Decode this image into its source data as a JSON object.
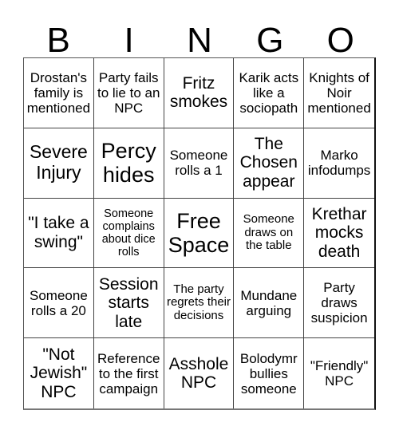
{
  "header": {
    "letters": [
      "B",
      "I",
      "N",
      "G",
      "O"
    ]
  },
  "board": {
    "cells": [
      "Drostan's family is mentioned",
      "Party fails to lie to an NPC",
      "Fritz smokes",
      "Karik acts like a sociopath",
      "Knights of Noir mentioned",
      "Severe Injury",
      "Percy hides",
      "Someone rolls a 1",
      "The Chosen appear",
      "Marko infodumps",
      "\"I take a swing\"",
      "Someone complains about dice rolls",
      "Free Space",
      "Someone draws on the table",
      "Krethar mocks death",
      "Someone rolls a 20",
      "Session starts late",
      "The party regrets their decisions",
      "Mundane arguing",
      "Party draws suspicion",
      "\"Not Jewish\" NPC",
      "Reference to the first campaign",
      "Asshole NPC",
      "Bolodymr bullies someone",
      "\"Friendly\" NPC"
    ]
  }
}
